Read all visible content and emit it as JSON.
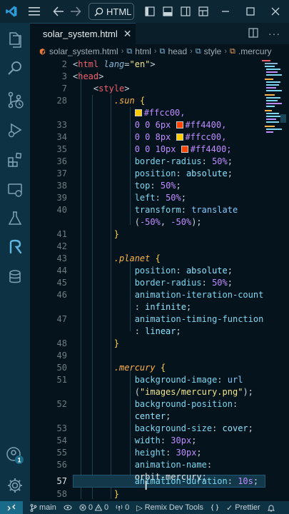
{
  "titlebar": {
    "search_text": "HTML"
  },
  "tab": {
    "filename": "solar_system.html"
  },
  "breadcrumb": {
    "items": [
      "solar_system.html",
      "html",
      "head",
      "style",
      ".mercury"
    ]
  },
  "gutter": {
    "line_numbers": [
      "2",
      "3",
      "7",
      "28",
      "",
      "33",
      "34",
      "35",
      "36",
      "37",
      "38",
      "39",
      "40",
      "",
      "41",
      "42",
      "43",
      "44",
      "45",
      "46",
      "",
      "47",
      "",
      "48",
      "49",
      "50",
      "51",
      "",
      "52",
      "",
      "53",
      "54",
      "55",
      "56",
      "",
      "57",
      "58"
    ]
  },
  "code": {
    "l2": {
      "open": "<",
      "tag": "html",
      "attr": "lang",
      "eq": "=",
      "str": "\"en\"",
      "close": ">"
    },
    "l3": {
      "open": "<",
      "tag": "head",
      "close": ">"
    },
    "l7": {
      "open": "<",
      "tag": "style",
      "close": ">"
    },
    "l28": {
      "selector": ".sun",
      "brace": "{"
    },
    "l28b": {
      "value": "#ffcc00,"
    },
    "l33": {
      "nums": "0 0 6px",
      "value": "#ff4400,"
    },
    "l34": {
      "nums": "0 0 8px",
      "value": "#ffcc00,"
    },
    "l35": {
      "nums": "0 0 10px",
      "value": "#ff4400;"
    },
    "l36": {
      "prop": "border-radius",
      "num": "50%",
      "end": ";"
    },
    "l37": {
      "prop": "position",
      "val": "absolute",
      "end": ";"
    },
    "l38": {
      "prop": "top",
      "num": "50%",
      "end": ";"
    },
    "l39": {
      "prop": "left",
      "num": "50%",
      "end": ";"
    },
    "l40": {
      "prop": "transform",
      "fn": "translate"
    },
    "l40b": {
      "open": "(",
      "num1": "-50%",
      "sep": ", ",
      "num2": "-50%",
      "close": ");"
    },
    "l41": {
      "brace": "}"
    },
    "l43": {
      "selector": ".planet",
      "brace": "{"
    },
    "l44": {
      "prop": "position",
      "val": "absolute",
      "end": ";"
    },
    "l45": {
      "prop": "border-radius",
      "num": "50%",
      "end": ";"
    },
    "l46": {
      "prop": "animation-iteration-count"
    },
    "l46b": {
      "colon": ": ",
      "val": "infinite",
      "end": ";"
    },
    "l47": {
      "prop": "animation-timing-function"
    },
    "l47b": {
      "colon": ": ",
      "val": "linear",
      "end": ";"
    },
    "l48": {
      "brace": "}"
    },
    "l50": {
      "selector": ".mercury",
      "brace": "{"
    },
    "l51": {
      "prop": "background-image",
      "fn": "url"
    },
    "l51b": {
      "open": "(",
      "str": "\"images/mercury.png\"",
      "close": ");"
    },
    "l52": {
      "prop": "background-position"
    },
    "l52b": {
      "val": "center",
      "end": ";"
    },
    "l53": {
      "prop": "background-size",
      "val": "cover",
      "end": ";"
    },
    "l54": {
      "prop": "width",
      "num": "30px",
      "end": ";"
    },
    "l55": {
      "prop": "height",
      "num": "30px",
      "end": ";"
    },
    "l56": {
      "prop": "animation-name",
      "end": ":"
    },
    "l56b": {
      "val": "orbit-mercury",
      "end": ";"
    },
    "l57": {
      "prop": "animation-duration",
      "num": "10s",
      "end": ";"
    },
    "l58": {
      "brace": "}"
    }
  },
  "colors": {
    "swatch_yellow": "#ffcc00",
    "swatch_red": "#ff4400"
  },
  "statusbar": {
    "branch": "main",
    "errors": "0",
    "warnings": "0",
    "ports": "0",
    "remix": "Remix Dev Tools",
    "prettier": "Prettier"
  }
}
